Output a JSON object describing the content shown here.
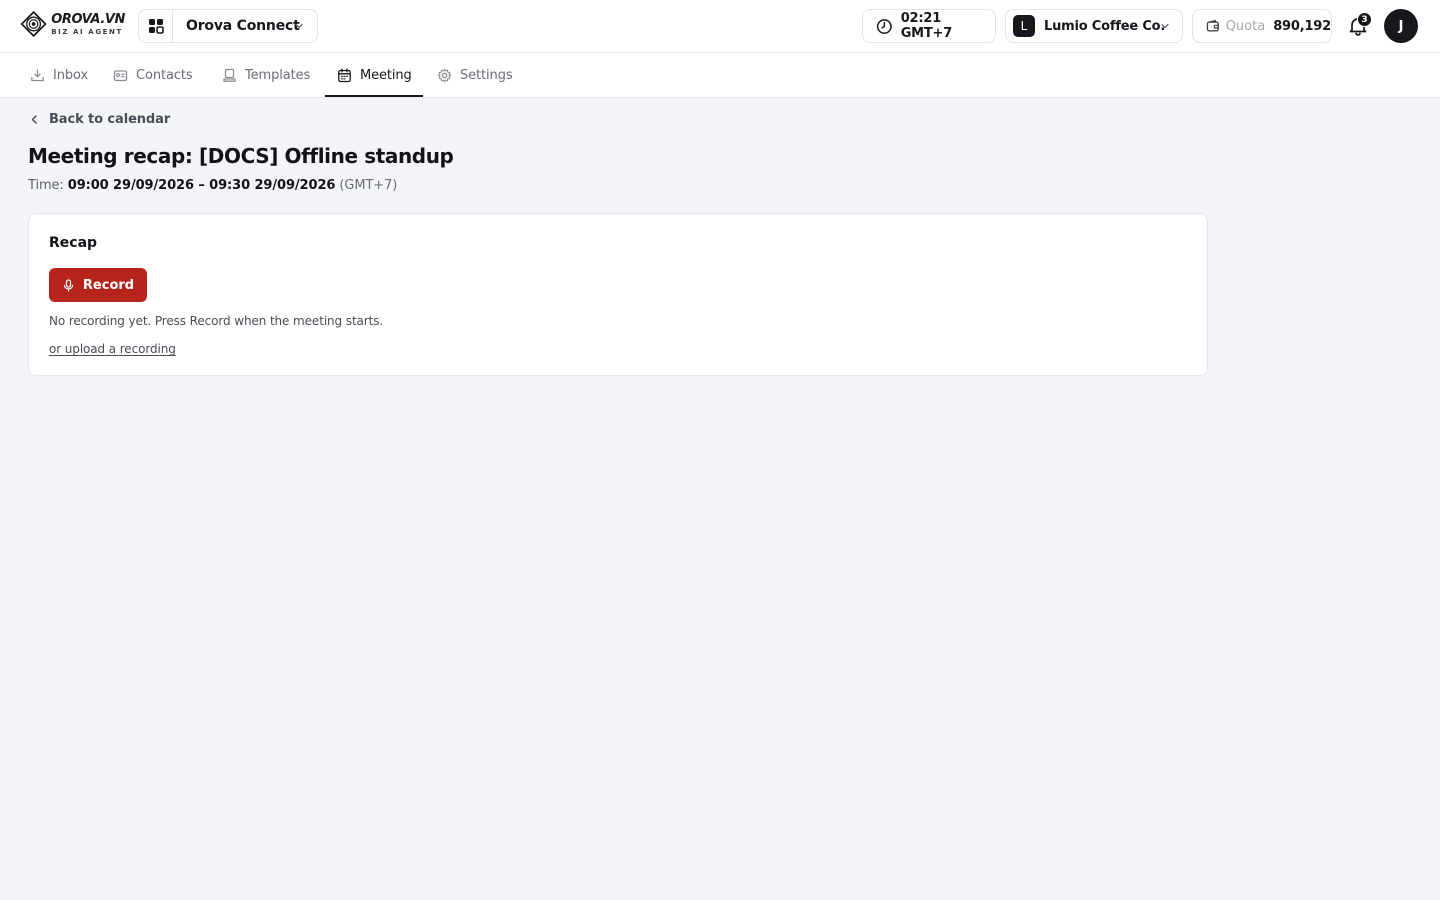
{
  "brand": {
    "name": "OROVA.VN",
    "tagline": "BIZ AI AGENT"
  },
  "workspace": {
    "name": "Orova Connect"
  },
  "header": {
    "time": "02:21 GMT+7",
    "organization": {
      "initial": "L",
      "name": "Lumio Coffee Co."
    },
    "quota": {
      "label": "Quota",
      "value": "890,192"
    },
    "notifications": {
      "count": "3"
    },
    "user": {
      "initial": "J"
    }
  },
  "tabs": [
    {
      "label": "Inbox",
      "icon": "inbox-icon",
      "active": false
    },
    {
      "label": "Contacts",
      "icon": "contact-card-icon",
      "active": false
    },
    {
      "label": "Templates",
      "icon": "template-icon",
      "active": false
    },
    {
      "label": "Meeting",
      "icon": "calendar-icon",
      "active": true
    },
    {
      "label": "Settings",
      "icon": "gear-icon",
      "active": false
    }
  ],
  "page": {
    "back_label": "Back to calendar",
    "title": "Meeting recap: [DOCS] Offline standup",
    "time_label": "Time:",
    "time_range": "09:00 29/09/2026 – 09:30 29/09/2026",
    "timezone": "(GMT+7)"
  },
  "recap": {
    "title": "Recap",
    "record_label": "Record",
    "empty_note": "No recording yet. Press Record when the meeting starts.",
    "upload_label": "or upload a recording"
  },
  "colors": {
    "accent": "#b6241c",
    "dark": "#16181d"
  }
}
